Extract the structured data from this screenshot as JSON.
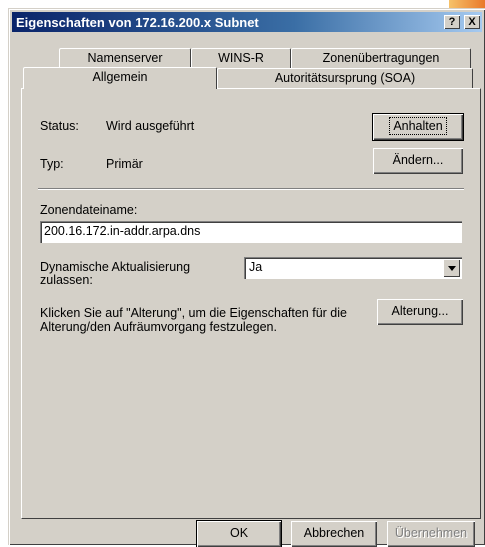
{
  "window": {
    "title": "Eigenschaften von 172.16.200.x Subnet",
    "help_label": "?",
    "close_label": "X"
  },
  "tabs": {
    "row_back": [
      "Namenserver",
      "WINS-R",
      "Zonenübertragungen"
    ],
    "row_front": [
      "Allgemein",
      "Autoritätsursprung (SOA)"
    ],
    "active": "Allgemein"
  },
  "general": {
    "status_label": "Status:",
    "status_value": "Wird ausgeführt",
    "pause_button": "Anhalten",
    "type_label": "Typ:",
    "type_value": "Primär",
    "change_button": "Ändern...",
    "zonefile_label": "Zonendateiname:",
    "zonefile_value": "200.16.172.in-addr.arpa.dns",
    "dynamic_label_line1": "Dynamische Aktualisierung",
    "dynamic_label_line2": "zulassen:",
    "dynamic_value": "Ja",
    "aging_text_line1": "Klicken Sie auf \"Alterung\", um die Eigenschaften für die",
    "aging_text_line2": "Alterung/den Aufräumvorgang festzulegen.",
    "aging_button": "Alterung..."
  },
  "footer": {
    "ok_button": "OK",
    "cancel_button": "Abbrechen",
    "apply_button": "Übernehmen"
  }
}
